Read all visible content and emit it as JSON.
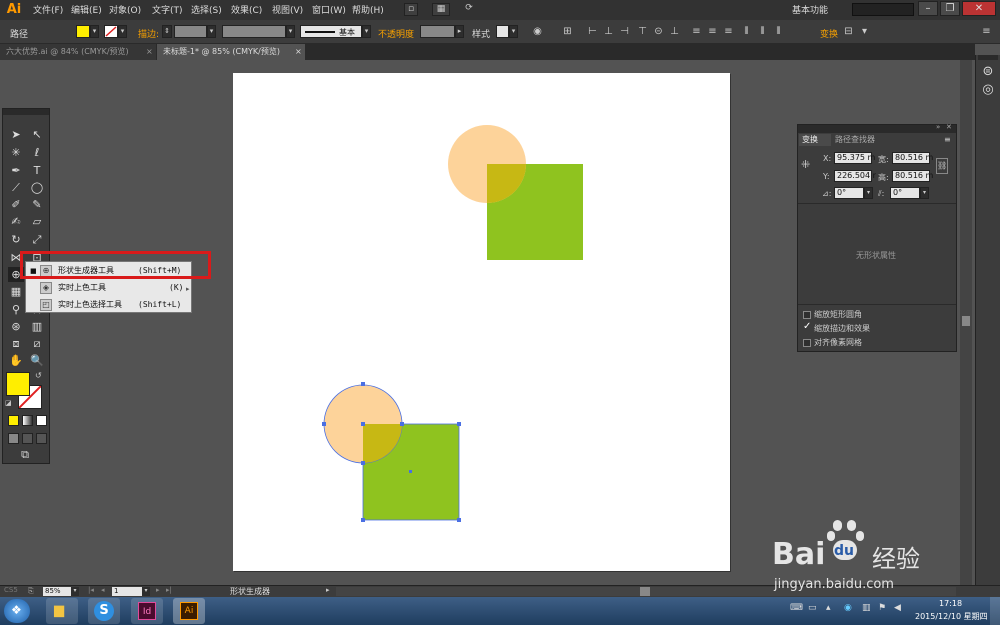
{
  "app": {
    "logo": "Ai",
    "workspace": "基本功能"
  },
  "menu": [
    "文件(F)",
    "编辑(E)",
    "对象(O)",
    "文字(T)",
    "选择(S)",
    "效果(C)",
    "视图(V)",
    "窗口(W)",
    "帮助(H)"
  ],
  "control": {
    "object_type": "路径",
    "stroke_label": "描边:",
    "stroke_style": "基本",
    "opacity_label": "不透明度",
    "style_label": "样式",
    "transform_label": "变换",
    "fill_color": "#ffee00",
    "accent_color": "#f6a000"
  },
  "tabs": [
    {
      "label": "六大优势.ai @ 84% (CMYK/预览)",
      "active": false
    },
    {
      "label": "未标题-1* @ 85% (CMYK/预览)",
      "active": true
    }
  ],
  "flyout": {
    "items": [
      {
        "label": "形状生成器工具",
        "shortcut": "(Shift+M)",
        "icon": "shape-builder-icon",
        "selected": true
      },
      {
        "label": "实时上色工具",
        "shortcut": "(K)",
        "icon": "live-paint-bucket-icon",
        "selected": false
      },
      {
        "label": "实时上色选择工具",
        "shortcut": "(Shift+L)",
        "icon": "live-paint-selection-icon",
        "selected": false
      }
    ]
  },
  "transform_panel": {
    "tabs": [
      "变换",
      "路径查找器"
    ],
    "x_label": "X:",
    "x_value": "95.375 m",
    "y_label": "Y:",
    "y_value": "226.504 r",
    "w_label": "宽:",
    "w_value": "80.516 m",
    "h_label": "高:",
    "h_value": "80.516 m",
    "rotate_value": "0°",
    "shear_value": "0°",
    "no_shape": "无形状属性",
    "options": [
      {
        "label": "缩放矩形圆角",
        "checked": false
      },
      {
        "label": "缩放描边和效果",
        "checked": true
      },
      {
        "label": "对齐像素网格",
        "checked": false
      }
    ]
  },
  "status": {
    "zoom": "85%",
    "page": "1",
    "tool_name": "形状生成器"
  },
  "taskbar": {
    "time": "17:18",
    "date": "2015/12/10 星期四"
  },
  "watermark": {
    "brand": "Bai",
    "brand2": "du",
    "cn": "经验",
    "url": "jingyan.baidu.com"
  },
  "colors": {
    "green": "#8fc31f",
    "peach": "#fdd39a",
    "overlap": "#c7b814",
    "selection": "#4a6fe3"
  }
}
